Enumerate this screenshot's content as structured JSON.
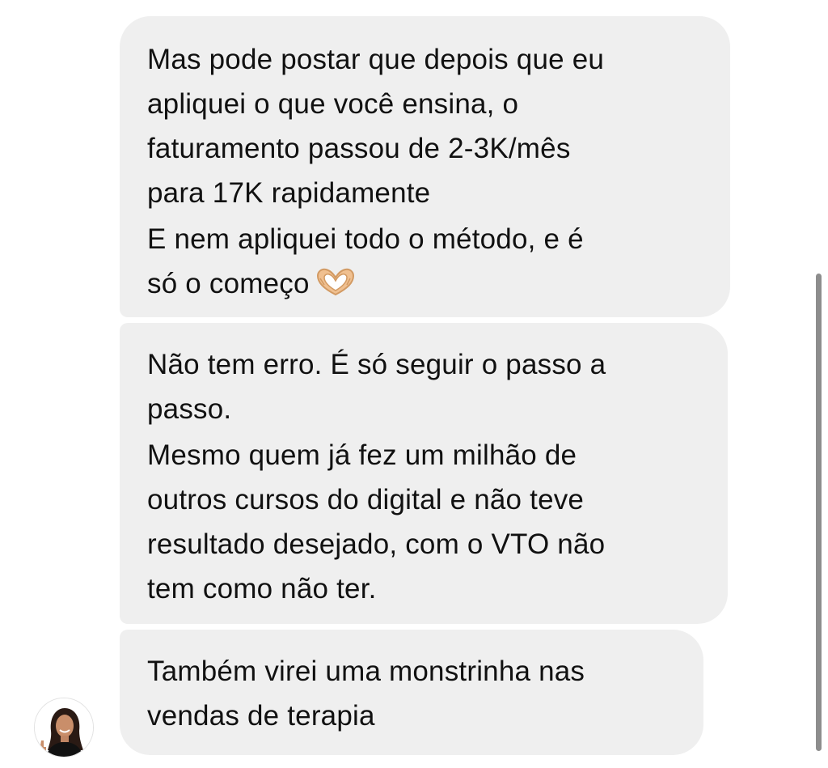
{
  "messages": [
    {
      "paragraphs": [
        "Mas pode postar que depois que eu\napliquei o que você ensina, o\nfaturamento passou de 2-3K/mês\npara 17K rapidamente",
        "E nem apliquei todo o método, e é\nsó o começo"
      ],
      "emoji": "heart-hands-emoji"
    },
    {
      "paragraphs": [
        "Não tem erro. É só seguir o passo a\npasso.",
        "Mesmo quem já fez um milhão de\noutros cursos do digital e não teve\nresultado desejado, com o VTO não\ntem como não ter."
      ]
    },
    {
      "paragraphs": [
        "Também virei uma monstrinha nas\nvendas de terapia"
      ]
    }
  ],
  "sender": {
    "avatar_icon": "profile-photo"
  },
  "colors": {
    "bubble_background": "#efefef",
    "text": "#111111",
    "page_background": "#ffffff",
    "scrollbar": "#8d8d8d"
  }
}
